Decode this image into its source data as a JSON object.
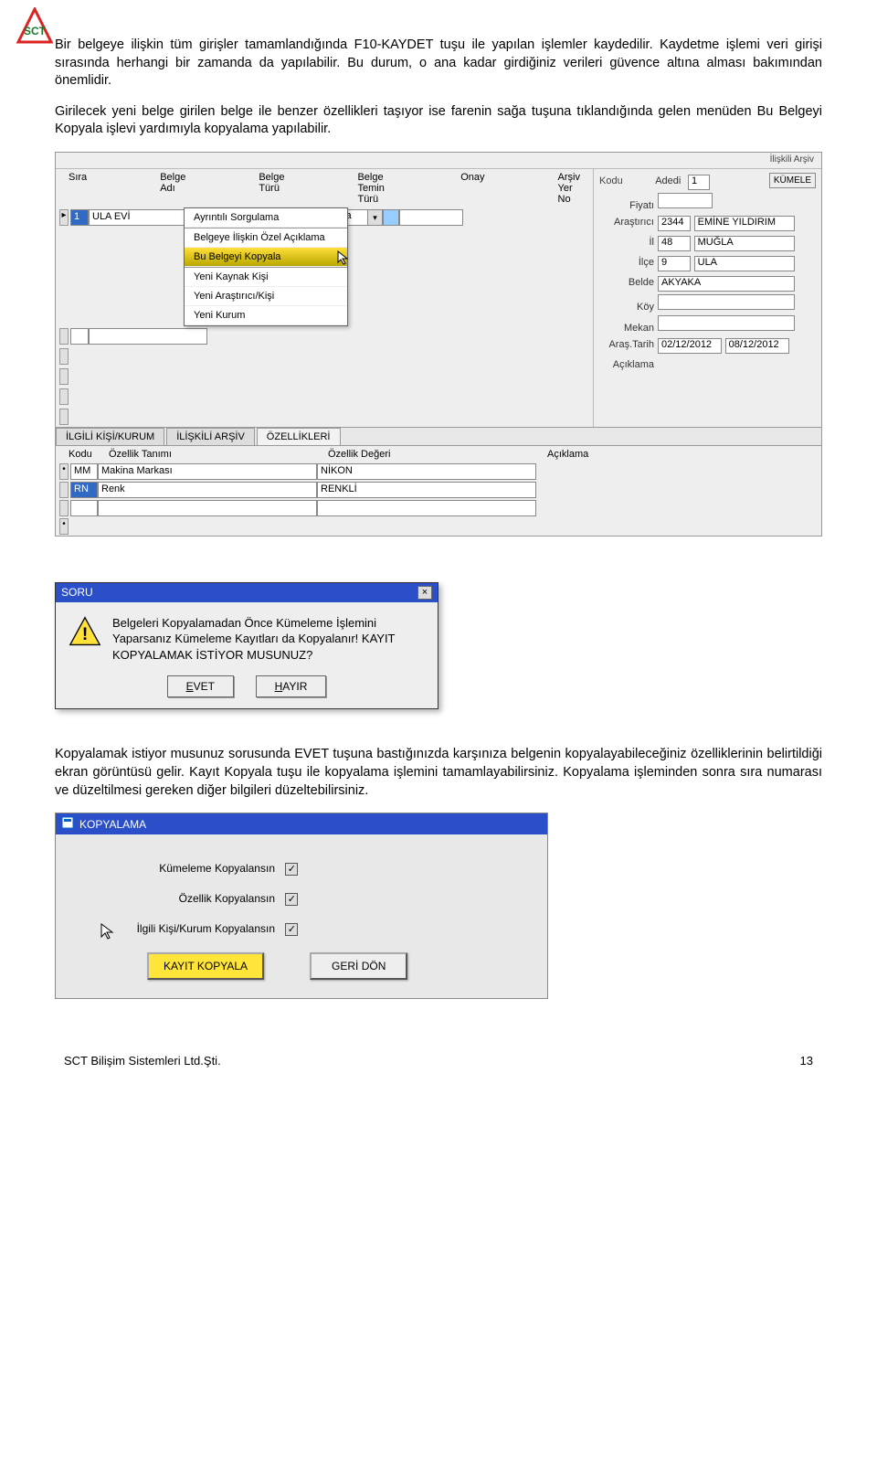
{
  "paragraphs": {
    "p1": "Bir belgeye ilişkin tüm girişler tamamlandığında F10-KAYDET tuşu ile yapılan işlemler kaydedilir. Kaydetme işlemi veri girişi sırasında herhangi bir zamanda da yapılabilir. Bu durum, o ana kadar girdiğiniz verileri güvence altına alması bakımından önemlidir.",
    "p2": "Girilecek yeni belge girilen belge ile benzer özellikleri taşıyor ise farenin sağa tuşuna tıklandığında gelen menüden Bu Belgeyi Kopyala işlevi yardımıyla kopyalama yapılabilir.",
    "p3": "Kopyalamak istiyor musunuz sorusunda EVET tuşuna bastığınızda karşınıza belgenin kopyalayabileceğiniz özelliklerinin belirtildiği ekran görüntüsü gelir. Kayıt Kopyala tuşu ile kopyalama işlemini tamamlayabilirsiniz. Kopyalama işleminden sonra sıra numarası ve düzeltilmesi gereken diğer bilgileri düzeltebilirsiniz."
  },
  "screenshot1": {
    "top_right_group": "İlişkili Arşiv",
    "columns": {
      "sira": "Sıra",
      "belge_adi": "Belge Adı",
      "belge_turu": "Belge Türü",
      "temin": "Belge Temin Türü",
      "onay": "Onay",
      "arsiv": "Arşiv Yer No"
    },
    "row1": {
      "sira": "1",
      "belge_adi": "ULA EVİ",
      "temin": "Araştırma"
    },
    "context_menu": {
      "items": [
        "Ayrıntılı Sorgulama",
        "Belgeye İlişkin Özel Açıklama",
        "Bu Belgeyi Kopyala",
        "Yeni Kaynak Kişi",
        "Yeni Araştırıcı/Kişi",
        "Yeni Kurum"
      ],
      "highlighted_index": 2
    },
    "right_panel": {
      "kodu": "Kodu",
      "adedi_l": "Adedi",
      "adedi_v": "1",
      "fiyati_l": "Fiyatı",
      "arastirici_l": "Araştırıcı",
      "arastirici_code": "2344",
      "arastirici_name": "EMİNE YILDIRIM",
      "il_l": "İl",
      "il_code": "48",
      "il_name": "MUĞLA",
      "ilce_l": "İlçe",
      "ilce_code": "9",
      "ilce_name": "ULA",
      "belde_l": "Belde",
      "belde_name": "AKYAKA",
      "koy_l": "Köy",
      "mekan_l": "Mekan",
      "tarih_l": "Araş.Tarih",
      "tarih1": "02/12/2012",
      "tarih2": "08/12/2012",
      "aciklama_l": "Açıklama",
      "kumele": "KÜMELE"
    },
    "tabs": {
      "t1": "İLGİLİ KİŞİ/KURUM",
      "t2": "İLİŞKİLİ ARŞİV",
      "t3": "ÖZELLİKLERİ"
    },
    "subgrid": {
      "headers": {
        "kodu": "Kodu",
        "tanim": "Özellik Tanımı",
        "deger": "Özellik Değeri",
        "aciklama": "Açıklama"
      },
      "rows": [
        {
          "kodu": "MM",
          "tanim": "Makina Markası",
          "deger": "NİKON"
        },
        {
          "kodu": "RN",
          "tanim": "Renk",
          "deger": "RENKLİ"
        }
      ]
    }
  },
  "msgbox": {
    "title": "SORU",
    "text": "Belgeleri Kopyalamadan Önce Kümeleme İşlemini Yaparsanız Kümeleme Kayıtları da Kopyalanır! KAYIT KOPYALAMAK İSTİYOR MUSUNUZ?",
    "yes": "EVET",
    "no": "HAYIR"
  },
  "copy_dialog": {
    "title": "KOPYALAMA",
    "opt1": "Kümeleme Kopyalansın",
    "opt2": "Özellik Kopyalansın",
    "opt3": "İlgili Kişi/Kurum Kopyalansın",
    "btn_copy": "KAYIT KOPYALA",
    "btn_back": "GERİ DÖN"
  },
  "footer": {
    "company": "SCT Bilişim Sistemleri Ltd.Şti.",
    "page": "13"
  }
}
